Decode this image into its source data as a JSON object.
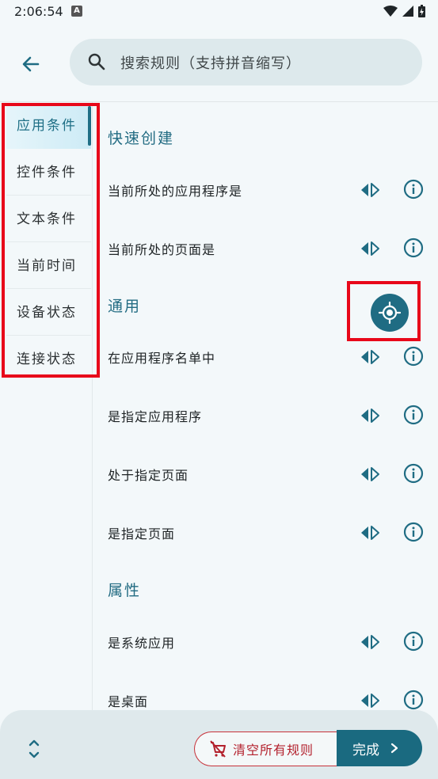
{
  "status": {
    "time": "2:06:54",
    "notif_letter": "A"
  },
  "search": {
    "placeholder": "搜索规则（支持拼音缩写）"
  },
  "sidebar": {
    "items": [
      {
        "label": "应用条件",
        "active": true
      },
      {
        "label": "控件条件"
      },
      {
        "label": "文本条件"
      },
      {
        "label": "当前时间"
      },
      {
        "label": "设备状态"
      },
      {
        "label": "连接状态"
      }
    ]
  },
  "sections": {
    "quick": {
      "title": "快速创建",
      "rows": [
        "当前所处的应用程序是",
        "当前所处的页面是"
      ]
    },
    "general": {
      "title": "通用",
      "rows": [
        "在应用程序名单中",
        "是指定应用程序",
        "处于指定页面",
        "是指定页面"
      ]
    },
    "attributes": {
      "title": "属性",
      "rows": [
        "是系统应用",
        "是桌面"
      ]
    }
  },
  "bottom": {
    "clear_label": "清空所有规则",
    "done_label": "完成"
  },
  "colors": {
    "accent": "#1f6c83",
    "danger": "#c7323a",
    "background": "#f3f8fa"
  }
}
